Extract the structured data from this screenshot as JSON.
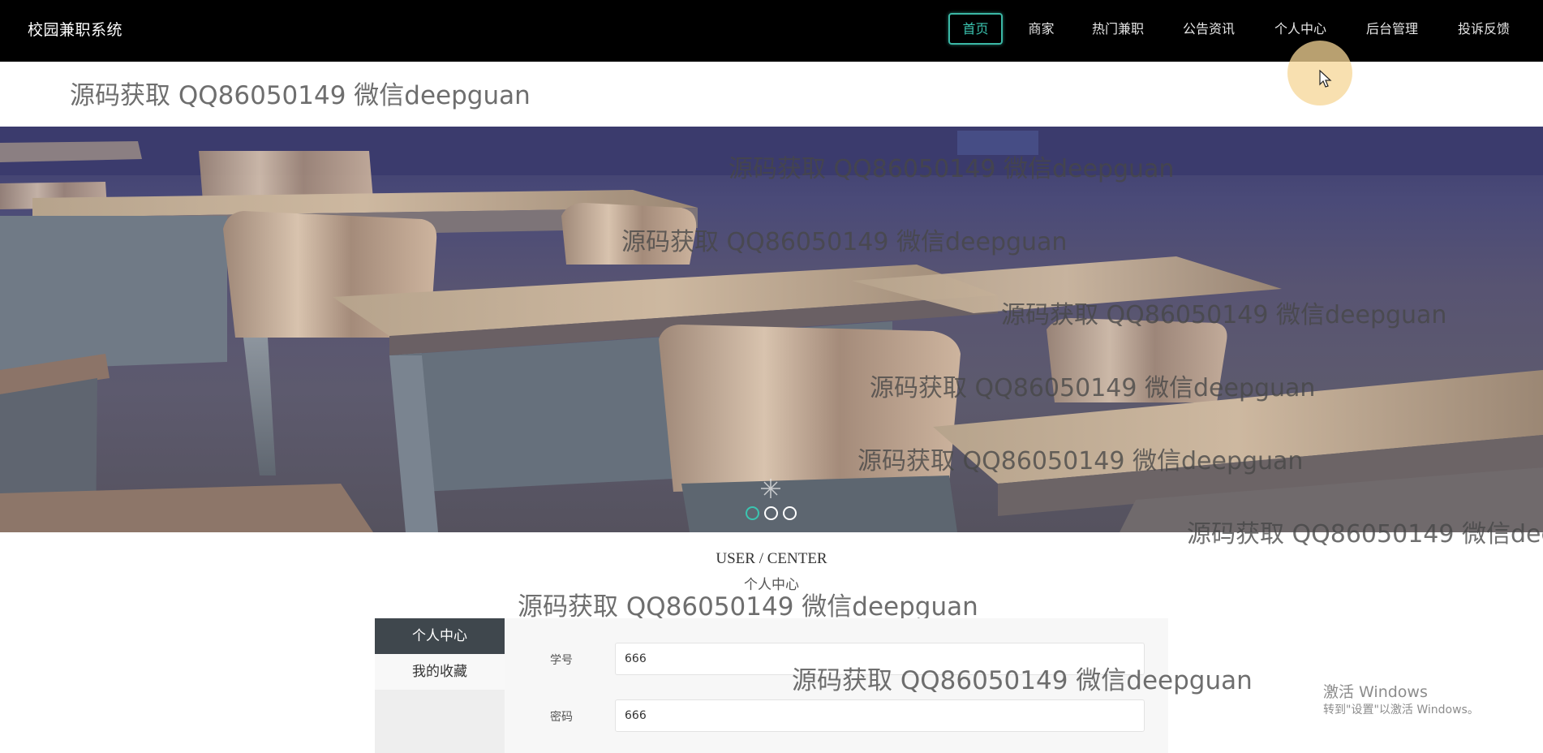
{
  "header": {
    "brand": "校园兼职系统",
    "nav": [
      {
        "label": "首页",
        "active": true
      },
      {
        "label": "商家",
        "active": false
      },
      {
        "label": "热门兼职",
        "active": false
      },
      {
        "label": "公告资讯",
        "active": false
      },
      {
        "label": "个人中心",
        "active": false
      },
      {
        "label": "后台管理",
        "active": false
      },
      {
        "label": "投诉反馈",
        "active": false
      }
    ]
  },
  "watermark": {
    "text": "源码获取 QQ86050149 微信deepguan"
  },
  "carousel": {
    "slide_count": 3,
    "active_index": 0
  },
  "section": {
    "title_en": "USER / CENTER",
    "title_cn": "个人中心"
  },
  "sidebar": {
    "items": [
      {
        "label": "个人中心",
        "active": true
      },
      {
        "label": "我的收藏",
        "active": false
      }
    ]
  },
  "form": {
    "fields": [
      {
        "label": "学号",
        "value": "666"
      },
      {
        "label": "密码",
        "value": "666"
      }
    ]
  },
  "system": {
    "activate_title": "激活 Windows",
    "activate_sub": "转到\"设置\"以激活 Windows。"
  },
  "colors": {
    "topbar": "#000000",
    "accent": "#3bc4b0",
    "sidebar_active": "#3f474d"
  }
}
